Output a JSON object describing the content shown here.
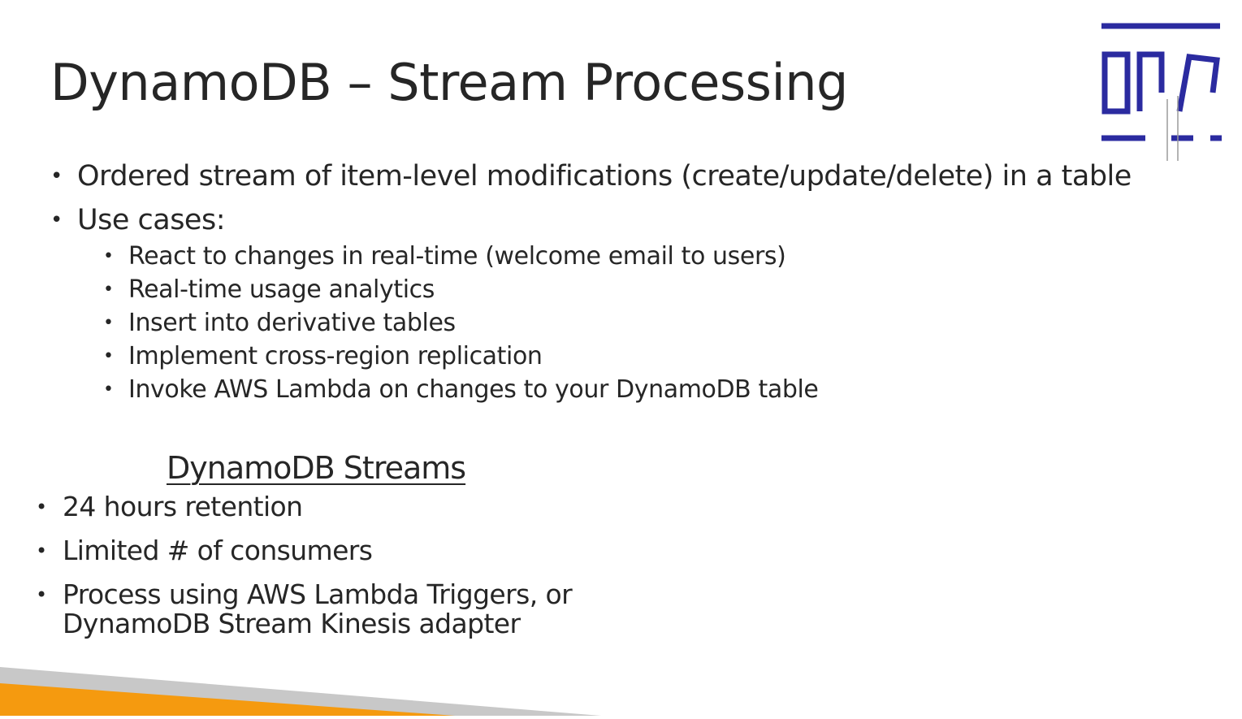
{
  "slide": {
    "title": "DynamoDB – Stream Processing",
    "bullets": [
      "Ordered stream of item-level modifications (create/update/delete) in a table",
      "Use cases:"
    ],
    "use_cases": [
      "React to changes in real-time (welcome email to users)",
      "Real-time usage analytics",
      "Insert into derivative tables",
      "Implement cross-region replication",
      "Invoke AWS Lambda on changes to your DynamoDB table"
    ],
    "streams_heading": "DynamoDB Streams",
    "streams_bullets": [
      "24 hours retention",
      "Limited # of consumers",
      "Process using AWS Lambda Triggers, or DynamoDB Stream Kinesis adapter"
    ]
  },
  "logo": {
    "icon": "brand-logo-icon",
    "color": "#2b2ba0"
  },
  "colors": {
    "text": "#262626",
    "accent_orange": "#f59a0f",
    "accent_gray": "#c8c8c8"
  }
}
